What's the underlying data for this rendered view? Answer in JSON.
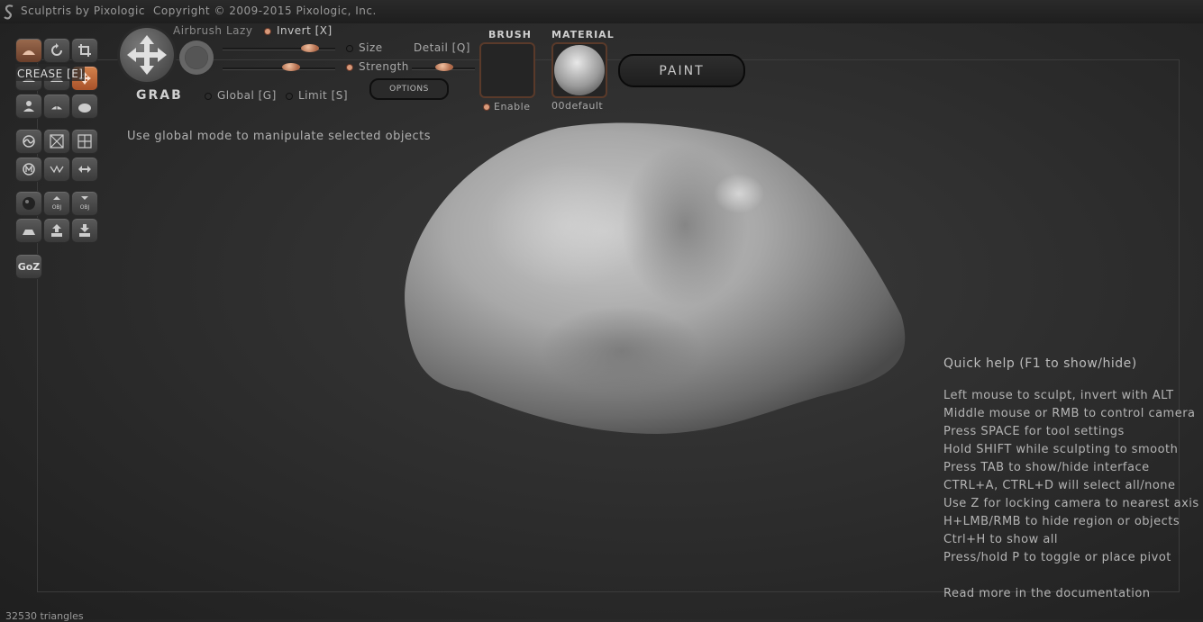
{
  "app": {
    "title": "Sculptris by Pixologic",
    "copyright": "Copyright © 2009-2015 Pixologic, Inc."
  },
  "toolbar": {
    "active_tool_tooltip": "CREASE [E]",
    "goz_label": "GoZ"
  },
  "tool": {
    "name": "GRAB",
    "airbrush": "Airbrush",
    "lazy": "Lazy",
    "invert": "Invert [X]",
    "size": "Size",
    "strength": "Strength",
    "detail": "Detail [Q]",
    "global": "Global [G]",
    "limit": "Limit [S]",
    "options": "OPTIONS",
    "hint": "Use global mode to manipulate selected objects"
  },
  "brush": {
    "header": "BRUSH",
    "enable": "Enable"
  },
  "material": {
    "header": "MATERIAL",
    "name": "00default"
  },
  "paint_button": "PAINT",
  "quickhelp": {
    "title": "Quick help (F1 to show/hide)",
    "lines": [
      "Left mouse to sculpt, invert with ALT",
      "Middle mouse or RMB to control camera",
      "Press SPACE for tool settings",
      "Hold SHIFT while sculpting to smooth",
      "Press TAB to show/hide interface",
      "CTRL+A, CTRL+D will select all/none",
      "Use Z for locking camera to nearest axis",
      "H+LMB/RMB to hide region or objects",
      "Ctrl+H to show all",
      "Press/hold P to toggle or place pivot"
    ],
    "docs_link": "Read more in the documentation"
  },
  "status": {
    "triangles": "32530 triangles"
  },
  "colors": {
    "accent": "#c8734a",
    "background": "#2e2e2e"
  }
}
